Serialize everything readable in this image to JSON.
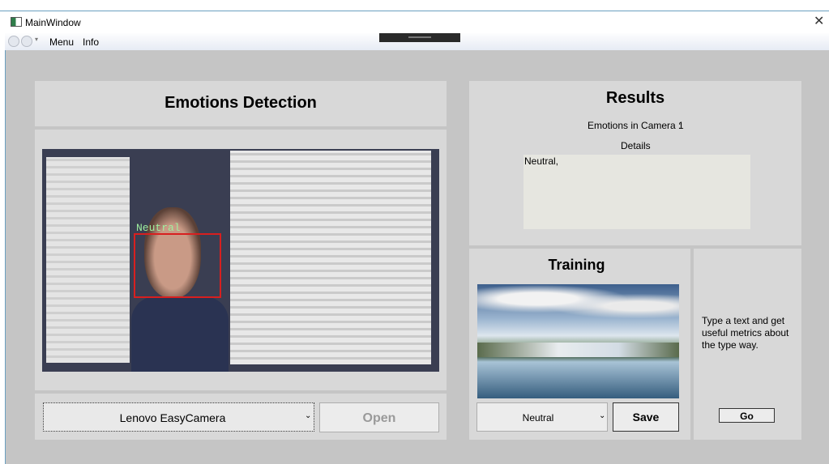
{
  "window": {
    "title": "MainWindow"
  },
  "menu": {
    "items": [
      "Menu",
      "Info"
    ]
  },
  "emotions": {
    "title": "Emotions Detection",
    "face_label": "Neutral"
  },
  "camera": {
    "selected": "Lenovo EasyCamera",
    "open_label": "Open"
  },
  "results": {
    "title": "Results",
    "count_label": "Emotions in Camera :",
    "count_value": "1",
    "details_label": "Details",
    "details_text": "Neutral,"
  },
  "training": {
    "title": "Training",
    "selected": "Neutral",
    "save_label": "Save"
  },
  "metrics": {
    "text": "Type a text and get useful metrics about the type way.",
    "go_label": "Go"
  }
}
